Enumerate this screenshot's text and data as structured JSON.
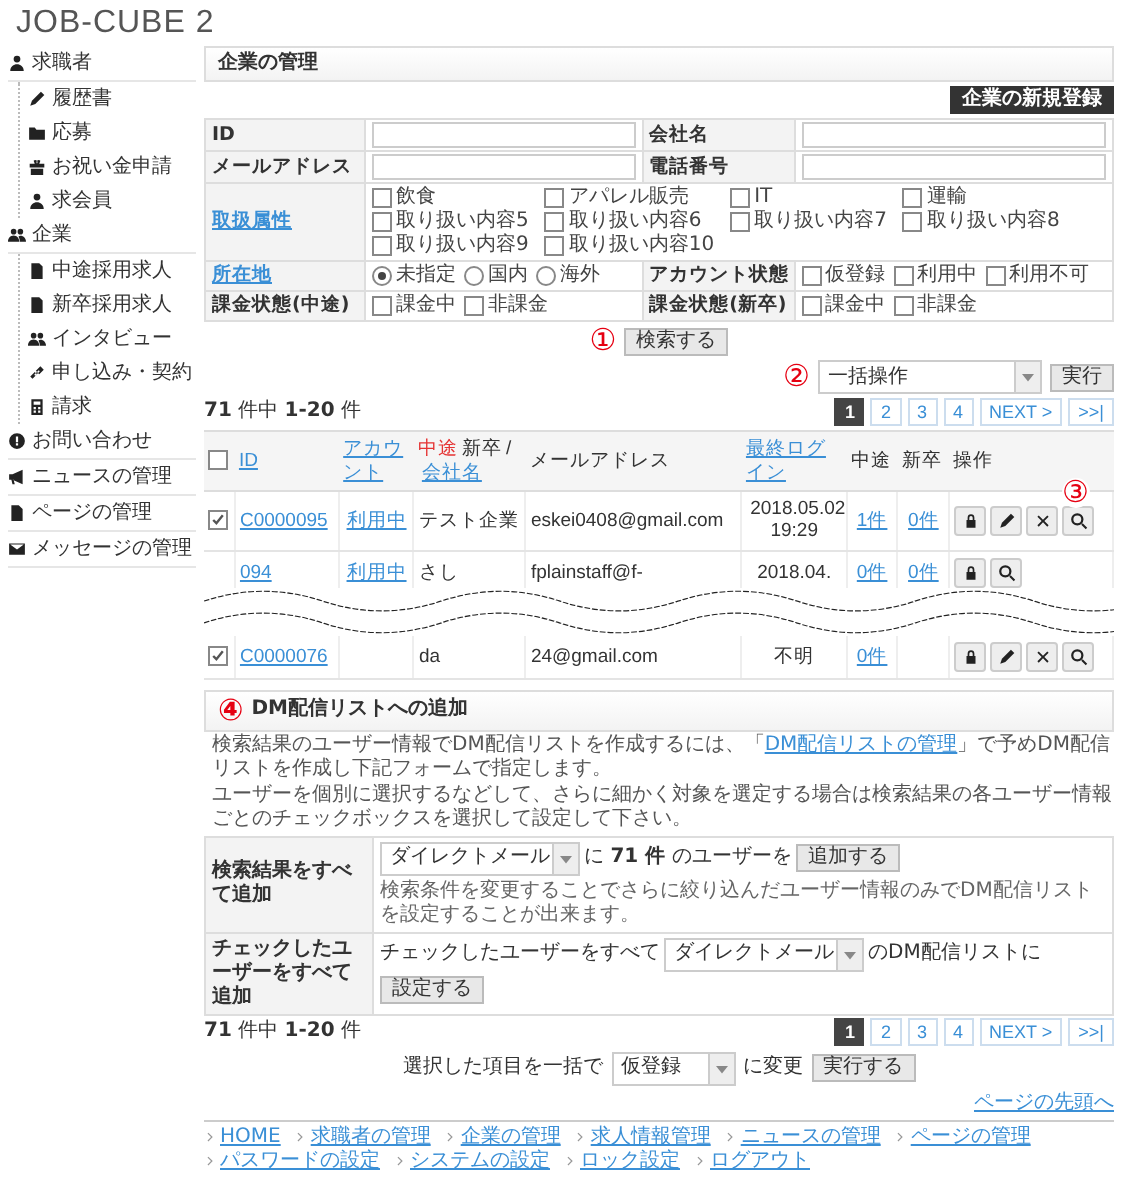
{
  "app": {
    "title": "JOB-CUBE 2"
  },
  "sidebar": {
    "items": [
      {
        "label": "求職者",
        "children": [
          {
            "label": "履歴書"
          },
          {
            "label": "応募"
          },
          {
            "label": "お祝い金申請"
          },
          {
            "label": "求会員"
          }
        ]
      },
      {
        "label": "企業",
        "children": [
          {
            "label": "中途採用求人"
          },
          {
            "label": "新卒採用求人"
          },
          {
            "label": "インタビュー"
          },
          {
            "label": "申し込み・契約"
          },
          {
            "label": "請求"
          }
        ]
      },
      {
        "label": "お問い合わせ"
      },
      {
        "label": "ニュースの管理"
      },
      {
        "label": "ページの管理"
      },
      {
        "label": "メッセージの管理"
      }
    ]
  },
  "panel": {
    "title": "企業の管理",
    "new_button": "企業の新規登録"
  },
  "search": {
    "fields": [
      {
        "kind": "text",
        "label": "ID",
        "link": false
      },
      {
        "kind": "text",
        "label": "会社名",
        "link": false
      },
      {
        "kind": "text",
        "label": "メールアドレス",
        "link": false
      },
      {
        "kind": "text",
        "label": "電話番号",
        "link": false
      },
      {
        "kind": "checks",
        "label": "取扱属性",
        "link": true,
        "wide": true,
        "options": [
          {
            "label": "飲食",
            "checked": false
          },
          {
            "label": "アパレル販売",
            "checked": false
          },
          {
            "label": "IT",
            "checked": false
          },
          {
            "label": "運輸",
            "checked": false
          },
          {
            "label": "取り扱い内容5",
            "checked": false
          },
          {
            "label": "取り扱い内容6",
            "checked": false
          },
          {
            "label": "取り扱い内容7",
            "checked": false
          },
          {
            "label": "取り扱い内容8",
            "checked": false
          },
          {
            "label": "取り扱い内容9",
            "checked": false
          },
          {
            "label": "取り扱い内容10",
            "checked": false
          }
        ]
      },
      {
        "kind": "radios",
        "label": "所在地",
        "link": true,
        "options": [
          {
            "label": "未指定",
            "selected": true
          },
          {
            "label": "国内",
            "selected": false
          },
          {
            "label": "海外",
            "selected": false
          }
        ]
      },
      {
        "kind": "checks",
        "label": "アカウント状態",
        "link": false,
        "options": [
          {
            "label": "仮登録",
            "checked": false
          },
          {
            "label": "利用中",
            "checked": false
          },
          {
            "label": "利用不可",
            "checked": false
          }
        ]
      },
      {
        "kind": "checks",
        "label": "課金状態(中途)",
        "link": false,
        "options": [
          {
            "label": "課金中",
            "checked": false
          },
          {
            "label": "非課金",
            "checked": false
          }
        ]
      },
      {
        "kind": "checks",
        "label": "課金状態(新卒)",
        "link": false,
        "options": [
          {
            "label": "課金中",
            "checked": false
          },
          {
            "label": "非課金",
            "checked": false
          }
        ]
      }
    ],
    "button": "検索する",
    "marker": "①"
  },
  "bulk_top": {
    "marker": "②",
    "select": "一括操作",
    "button": "実行"
  },
  "count": "**71** 件中 **1-20** 件",
  "pager": [
    {
      "label": "1",
      "selected": true
    },
    {
      "label": "2",
      "selected": false
    },
    {
      "label": "3",
      "selected": false
    },
    {
      "label": "4",
      "selected": false
    },
    {
      "label": "NEXT >",
      "selected": false
    },
    {
      "label": ">>|",
      "selected": false
    }
  ],
  "table": {
    "select_all_checked": false,
    "columns": [
      {
        "kind": "checkbox"
      },
      {
        "parts": [
          {
            "text": "ID",
            "kind": "link"
          }
        ]
      },
      {
        "parts": [
          {
            "text": "アカウント",
            "kind": "link"
          }
        ]
      },
      {
        "parts": [
          {
            "text": "中途",
            "kind": "accent"
          },
          {
            "text": "新卒",
            "kind": "plain"
          },
          {
            "text": "/",
            "kind": "plain"
          },
          {
            "text": "会社名",
            "kind": "link"
          }
        ]
      },
      {
        "parts": [
          {
            "text": "メールアドレス",
            "kind": "plain"
          }
        ]
      },
      {
        "parts": [
          {
            "text": "最終ログイン",
            "kind": "link"
          }
        ]
      },
      {
        "parts": [
          {
            "text": "中途",
            "kind": "plain"
          }
        ]
      },
      {
        "parts": [
          {
            "text": "新卒",
            "kind": "plain"
          }
        ]
      },
      {
        "parts": [
          {
            "text": "操作",
            "kind": "plain"
          }
        ]
      }
    ],
    "actions_marker": "③",
    "rows": [
      {
        "checked": true,
        "id": "C0000095",
        "account": "利用中",
        "company": "テスト企業",
        "email": "eskei0408@gmail.com",
        "login": "2018.05.02 19:29",
        "mid": "1件",
        "new": "0件",
        "actions": [
          {
            "kind": "lock"
          },
          {
            "kind": "edit"
          },
          {
            "kind": "delete"
          },
          {
            "kind": "search"
          }
        ]
      },
      {
        "id": "094",
        "account": "利用中",
        "company": "さし",
        "email": "fplainstaff@f-",
        "login": "2018.04.",
        "mid": "0件",
        "new": "0件",
        "actions": [
          {
            "kind": "lock"
          },
          {
            "kind": "search"
          }
        ]
      },
      {
        "checked": true,
        "id": "C0000076",
        "company": "da",
        "email": "24@gmail.com",
        "login": "不明",
        "mid": "0件",
        "actions": [
          {
            "kind": "lock"
          },
          {
            "kind": "edit"
          },
          {
            "kind": "delete"
          },
          {
            "kind": "search"
          }
        ]
      }
    ]
  },
  "dm": {
    "marker": "④",
    "title": "DM配信リストへの追加",
    "intro": [
      {
        "before": "検索結果のユーザー情報でDM配信リストを作成するには、「",
        "link": "DM配信リストの管理",
        "after": "」で予めDM配信リストを作成し下記フォームで指定します。"
      },
      {
        "before": "ユーザーを個別に選択するなどして、さらに細かく対象を選定する場合は検索結果の各ユーザー情報ごとのチェックボックスを選択して設定して下さい。"
      }
    ],
    "rows": [
      {
        "label": "検索結果をすべて追加",
        "select": "ダイレクトメール",
        "mid": "に **71 件** のユーザーを",
        "button": "追加する",
        "note": "検索条件を変更することでさらに絞り込んだユーザー情報のみでDM配信リストを設定することが出来ます。"
      },
      {
        "label": "チェックしたユーザーをすべて追加",
        "lead": "チェックしたユーザーをすべて",
        "select": "ダイレクトメール",
        "mid": "のDM配信リストに",
        "button": "設定する"
      }
    ]
  },
  "count_bottom": "**71** 件中 **1-20** 件",
  "pager_bottom": [
    {
      "label": "1",
      "selected": true
    },
    {
      "label": "2",
      "selected": false
    },
    {
      "label": "3",
      "selected": false
    },
    {
      "label": "4",
      "selected": false
    },
    {
      "label": "NEXT >",
      "selected": false
    },
    {
      "label": ">>|",
      "selected": false
    }
  ],
  "bulk_bottom": {
    "before": "選択した項目を一括で",
    "select": "仮登録",
    "after": "に変更",
    "button": "実行する"
  },
  "page_top": "ページの先頭へ",
  "footer": [
    "HOME",
    "求職者の管理",
    "企業の管理",
    "求人情報管理",
    "ニュースの管理",
    "ページの管理",
    "パスワードの設定",
    "システムの設定",
    "ロック設定",
    "ログアウト"
  ]
}
